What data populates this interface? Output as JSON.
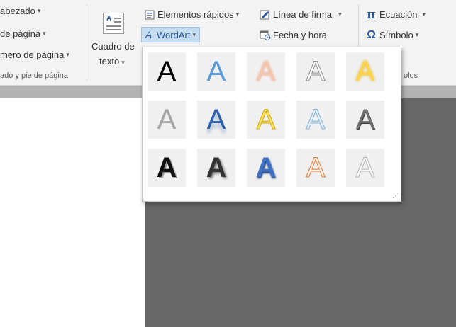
{
  "ribbon": {
    "header_footer_group": {
      "items": [
        "abezado",
        "de página",
        "mero de página"
      ],
      "group_label": "ado y pie de página"
    },
    "text_box": {
      "label_line1": "Cuadro de",
      "label_line2": "texto"
    },
    "text_group": {
      "quick_parts": "Elementos rápidos",
      "wordart": "WordArt",
      "signature_line": "Línea de firma",
      "date_time": "Fecha y hora"
    },
    "symbols_group": {
      "equation": "Ecuación",
      "symbol": "Símbolo",
      "group_label_fragment": "olos"
    }
  },
  "wordart_gallery": {
    "rows": [
      [
        "A",
        "A",
        "A",
        "A",
        "A"
      ],
      [
        "A",
        "A",
        "A",
        "A",
        "A"
      ],
      [
        "A",
        "A",
        "A",
        "A",
        "A"
      ]
    ]
  },
  "colors": {
    "accent_blue": "#2b579a",
    "wordart_hover": "#c6dcf1",
    "document_gray": "#676767"
  }
}
